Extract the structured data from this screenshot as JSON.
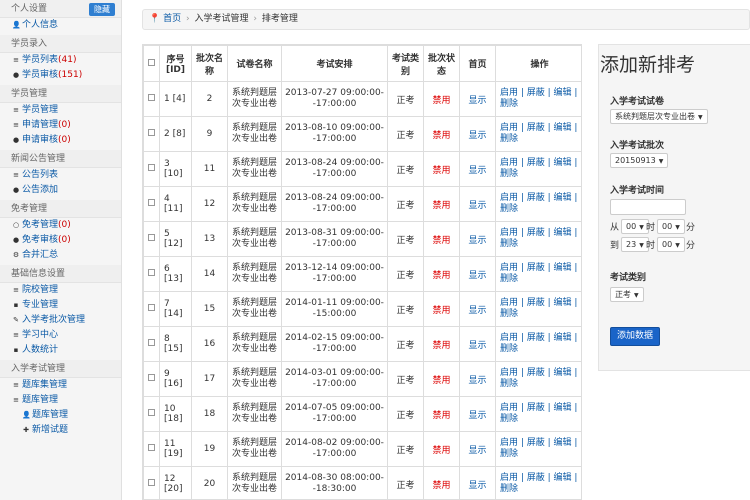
{
  "sidebar": {
    "hide_label": "隐藏",
    "sections": [
      {
        "header": "个人设置",
        "items": [
          {
            "icon": "user-icon",
            "glyph": "👤",
            "label": "个人信息"
          }
        ]
      },
      {
        "header": "学员录入",
        "items": [
          {
            "icon": "list-icon",
            "glyph": "≡",
            "label": "学员列表",
            "count": "(41)"
          },
          {
            "icon": "check-icon",
            "glyph": "●",
            "label": "学员审核",
            "count": "(151)"
          }
        ]
      },
      {
        "header": "学员管理",
        "items": [
          {
            "icon": "list-icon",
            "glyph": "≡",
            "label": "学员管理"
          },
          {
            "icon": "list-icon",
            "glyph": "≡",
            "label": "申请管理",
            "count": "(0)"
          },
          {
            "icon": "check-icon",
            "glyph": "●",
            "label": "申请审核",
            "count": "(0)"
          }
        ]
      },
      {
        "header": "新闻公告管理",
        "items": [
          {
            "icon": "list-icon",
            "glyph": "≡",
            "label": "公告列表"
          },
          {
            "icon": "add-icon",
            "glyph": "●",
            "label": "公告添加"
          }
        ]
      },
      {
        "header": "免考管理",
        "items": [
          {
            "icon": "circle-icon",
            "glyph": "○",
            "label": "免考管理",
            "count": "(0)"
          },
          {
            "icon": "check-icon",
            "glyph": "●",
            "label": "免考审核",
            "count": "(0)"
          },
          {
            "icon": "gear-icon",
            "glyph": "⚙",
            "label": "合并汇总"
          }
        ]
      },
      {
        "header": "基础信息设置",
        "items": [
          {
            "icon": "list-icon",
            "glyph": "≡",
            "label": "院校管理"
          },
          {
            "icon": "book-icon",
            "glyph": "▪",
            "label": "专业管理"
          },
          {
            "icon": "tag-icon",
            "glyph": "✎",
            "label": "入学考批次管理"
          },
          {
            "icon": "list-icon",
            "glyph": "≡",
            "label": "学习中心"
          },
          {
            "icon": "chart-icon",
            "glyph": "▪",
            "label": "人数统计"
          }
        ]
      },
      {
        "header": "入学考试管理",
        "items": [
          {
            "icon": "list-icon",
            "glyph": "≡",
            "label": "题库集管理"
          },
          {
            "icon": "list-icon",
            "glyph": "≡",
            "label": "题库管理"
          },
          {
            "icon": "user-icon",
            "glyph": "👤",
            "label": "题库管理",
            "sub": true
          },
          {
            "icon": "plus-icon",
            "glyph": "✚",
            "label": "新增试题",
            "sub": true
          }
        ]
      }
    ]
  },
  "breadcrumb": {
    "home": "首页",
    "items": [
      "入学考试管理",
      "排考管理"
    ]
  },
  "table": {
    "headers": [
      "序号[ID]",
      "批次名称",
      "试卷名称",
      "考试安排",
      "考试类别",
      "批次状态",
      "首页",
      "操作"
    ],
    "rows": [
      {
        "no": "1 [4]",
        "batch": "2",
        "paper": "系统判题层次专业出卷",
        "time": "2013-07-27 09:00:00--17:00:00",
        "type": "正考",
        "status": "禁用",
        "home": "显示",
        "ops": "启用 | 屏蔽 | 编辑 | 删除"
      },
      {
        "no": "2 [8]",
        "batch": "9",
        "paper": "系统判题层次专业出卷",
        "time": "2013-08-10 09:00:00--17:00:00",
        "type": "正考",
        "status": "禁用",
        "home": "显示",
        "ops": "启用 | 屏蔽 | 编辑 | 删除"
      },
      {
        "no": "3 [10]",
        "batch": "11",
        "paper": "系统判题层次专业出卷",
        "time": "2013-08-24 09:00:00--17:00:00",
        "type": "正考",
        "status": "禁用",
        "home": "显示",
        "ops": "启用 | 屏蔽 | 编辑 | 删除"
      },
      {
        "no": "4 [11]",
        "batch": "12",
        "paper": "系统判题层次专业出卷",
        "time": "2013-08-24 09:00:00--17:00:00",
        "type": "正考",
        "status": "禁用",
        "home": "显示",
        "ops": "启用 | 屏蔽 | 编辑 | 删除"
      },
      {
        "no": "5 [12]",
        "batch": "13",
        "paper": "系统判题层次专业出卷",
        "time": "2013-08-31 09:00:00--17:00:00",
        "type": "正考",
        "status": "禁用",
        "home": "显示",
        "ops": "启用 | 屏蔽 | 编辑 | 删除"
      },
      {
        "no": "6 [13]",
        "batch": "14",
        "paper": "系统判题层次专业出卷",
        "time": "2013-12-14 09:00:00--17:00:00",
        "type": "正考",
        "status": "禁用",
        "home": "显示",
        "ops": "启用 | 屏蔽 | 编辑 | 删除"
      },
      {
        "no": "7 [14]",
        "batch": "15",
        "paper": "系统判题层次专业出卷",
        "time": "2014-01-11 09:00:00--15:00:00",
        "type": "正考",
        "status": "禁用",
        "home": "显示",
        "ops": "启用 | 屏蔽 | 编辑 | 删除"
      },
      {
        "no": "8 [15]",
        "batch": "16",
        "paper": "系统判题层次专业出卷",
        "time": "2014-02-15 09:00:00--17:00:00",
        "type": "正考",
        "status": "禁用",
        "home": "显示",
        "ops": "启用 | 屏蔽 | 编辑 | 删除"
      },
      {
        "no": "9 [16]",
        "batch": "17",
        "paper": "系统判题层次专业出卷",
        "time": "2014-03-01 09:00:00--17:00:00",
        "type": "正考",
        "status": "禁用",
        "home": "显示",
        "ops": "启用 | 屏蔽 | 编辑 | 删除"
      },
      {
        "no": "10 [18]",
        "batch": "18",
        "paper": "系统判题层次专业出卷",
        "time": "2014-07-05 09:00:00--17:00:00",
        "type": "正考",
        "status": "禁用",
        "home": "显示",
        "ops": "启用 | 屏蔽 | 编辑 | 删除"
      },
      {
        "no": "11 [19]",
        "batch": "19",
        "paper": "系统判题层次专业出卷",
        "time": "2014-08-02 09:00:00--17:00:00",
        "type": "正考",
        "status": "禁用",
        "home": "显示",
        "ops": "启用 | 屏蔽 | 编辑 | 删除"
      },
      {
        "no": "12 [20]",
        "batch": "20",
        "paper": "系统判题层次专业出卷",
        "time": "2014-08-30 08:00:00--18:30:00",
        "type": "正考",
        "status": "禁用",
        "home": "显示",
        "ops": "启用 | 屏蔽 | 编辑 | 删除"
      }
    ]
  },
  "form": {
    "title": "添加新排考",
    "paper_label": "入学考试试卷",
    "paper_value": "系统判题层次专业出卷",
    "batch_label": "入学考试批次",
    "batch_value": "20150913",
    "time_label": "入学考试时间",
    "date_value": "",
    "from_label": "从",
    "to_label": "到",
    "hour_label": "时",
    "min_label": "分",
    "from_hour": "00",
    "from_min": "00",
    "to_hour": "23",
    "to_min": "00",
    "type_label": "考试类别",
    "type_value": "正考",
    "submit_label": "添加数据"
  },
  "colors": {
    "link": "#0b5aa6",
    "danger": "#d00000",
    "primary": "#1a64c8"
  }
}
